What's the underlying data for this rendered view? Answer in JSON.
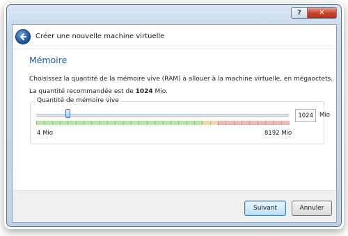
{
  "window": {
    "help_label": "?",
    "close_label": "✕"
  },
  "header": {
    "title": "Créer une nouvelle machine virtuelle",
    "back_icon": "back-arrow-icon"
  },
  "page": {
    "section_title": "Mémoire",
    "description": "Choisissez la quantité de la mémoire vive (RAM) à allouer à la machine virtuelle, en mégaoctets.",
    "recommended_prefix": "La quantité recommandée est de ",
    "recommended_value": "1024",
    "recommended_suffix": " Mio."
  },
  "memory": {
    "group_label": "Quantité de mémoire vive",
    "value": "1024",
    "unit": "Mio",
    "min_label": "4 Mio",
    "max_label": "8192 Mio",
    "slider_fraction": 0.125,
    "green_fraction": 0.66,
    "orange_fraction": 0.06,
    "colors": {
      "green": "#b8e6a6",
      "orange": "#f2d7a8",
      "red": "#f2b7b7",
      "accent": "#1d5aa4"
    }
  },
  "footer": {
    "next_label": "Suivant",
    "cancel_label": "Annuler"
  }
}
